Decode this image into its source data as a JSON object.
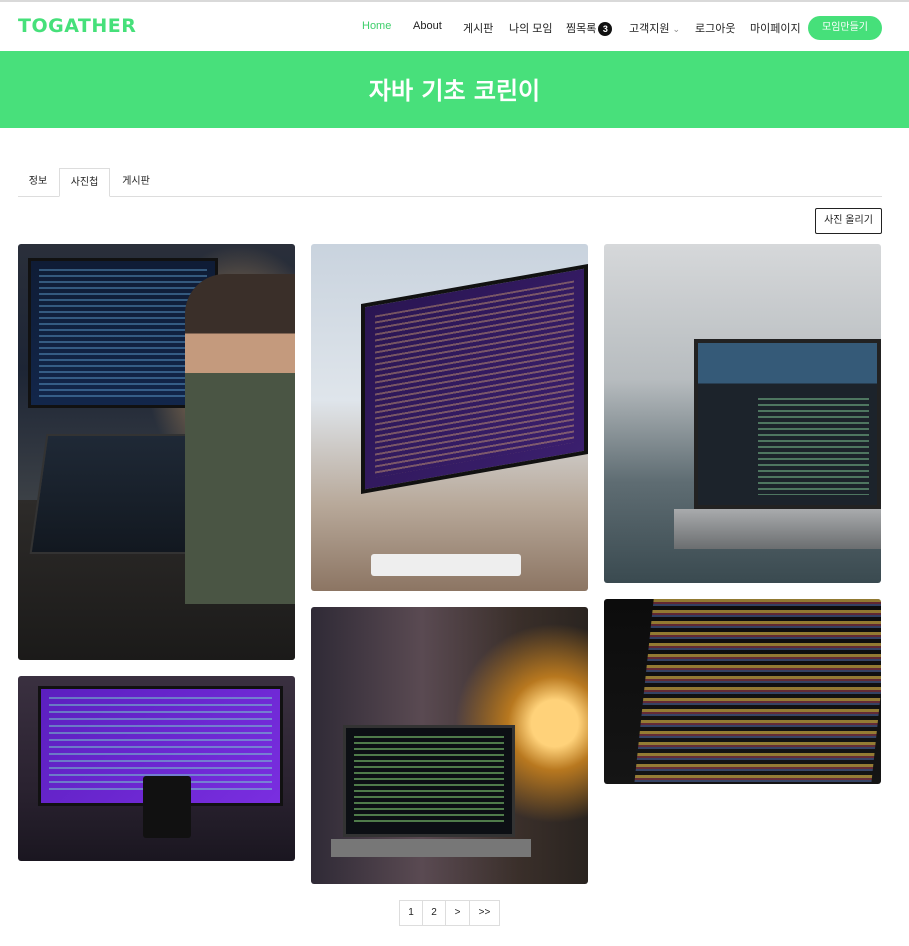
{
  "header": {
    "logo": "TOGATHER",
    "nav": [
      {
        "label": "Home",
        "active": true
      },
      {
        "label": "About"
      },
      {
        "label": "게시판"
      },
      {
        "label": "나의 모임"
      },
      {
        "label": "찜목록",
        "badge": "3"
      },
      {
        "label": "고객지원",
        "dropdown": true
      },
      {
        "label": "로그아웃"
      },
      {
        "label": "마이페이지"
      }
    ],
    "create_button": "모임만들기"
  },
  "banner": {
    "title": "자바 기초 코린이"
  },
  "tabs": [
    {
      "label": "정보"
    },
    {
      "label": "사진첩",
      "active": true
    },
    {
      "label": "게시판"
    }
  ],
  "upload_button": "사진 올리기",
  "photos": [
    {
      "subject": "developer at desk with monitor and laptop"
    },
    {
      "subject": "ultrawide monitor with code on desk"
    },
    {
      "subject": "laptop with code on bed"
    },
    {
      "subject": "monitor with purple code and mug"
    },
    {
      "subject": "laptop with code beside lamp"
    },
    {
      "subject": "closeup of python code on screen"
    }
  ],
  "pagination": [
    "1",
    "2",
    ">",
    ">>"
  ],
  "colors": {
    "brand": "#46e07a",
    "banner": "#48e07b",
    "active_nav": "#3ecf6b"
  }
}
